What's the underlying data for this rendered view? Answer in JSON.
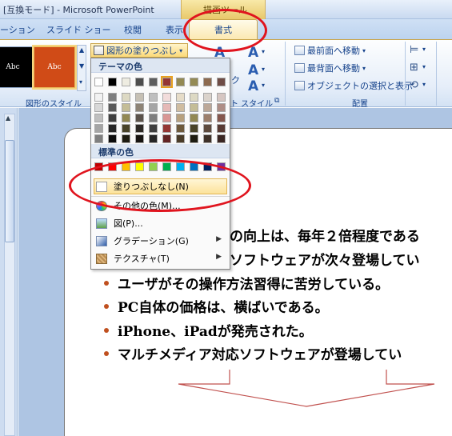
{
  "window": {
    "title": "[互換モード] - Microsoft PowerPoint",
    "contextual_tab_group": "描画ツール"
  },
  "tabs": [
    {
      "label": "ーション"
    },
    {
      "label": "スライド ショー"
    },
    {
      "label": "校閲"
    },
    {
      "label": "表示"
    },
    {
      "label": "書式",
      "active": true
    }
  ],
  "ribbon": {
    "shape_styles": {
      "group_label": "図形のスタイル",
      "style1_text": "Abc",
      "style2_text": "Abc",
      "fill_button": "図形の塗りつぶし"
    },
    "wordart_styles": {
      "group_label_partial": "ト スタイル",
      "fragment": "ク"
    },
    "arrange": {
      "group_label": "配置",
      "bring_front": "最前面へ移動",
      "send_back": "最背面へ移動",
      "selection_pane": "オブジェクトの選択と表示"
    }
  },
  "dropdown": {
    "theme_colors_header": "テーマの色",
    "standard_colors_header": "標準の色",
    "no_fill": "塗りつぶしなし(N)",
    "more_colors": "その他の色(M)...",
    "picture": "図(P)...",
    "gradient": "グラデーション(G)",
    "texture": "テクスチャ(T)",
    "theme_rows": [
      [
        "#ffffff",
        "#000000",
        "#eeece1",
        "#4d4d4d",
        "#5e5e5e",
        "#943634",
        "#938953",
        "#948a54",
        "#8d6a4f",
        "#6f4c45"
      ],
      [
        "#f2f2f2",
        "#7f7f7f",
        "#ddd9c3",
        "#c6c0b4",
        "#bfbfbf",
        "#f2dcdb",
        "#e6dcc8",
        "#ddd9c3",
        "#dbd3cb",
        "#d6c6c1"
      ],
      [
        "#d8d8d8",
        "#595959",
        "#c4bd97",
        "#8e8476",
        "#a5a5a5",
        "#e5b9b7",
        "#cfbca0",
        "#c4bd97",
        "#bca898",
        "#ae8e86"
      ],
      [
        "#bfbfbf",
        "#3f3f3f",
        "#938953",
        "#5b524a",
        "#7f7f7f",
        "#d99694",
        "#b7a07e",
        "#938953",
        "#9c7f6b",
        "#85574d"
      ],
      [
        "#a5a5a5",
        "#262626",
        "#494429",
        "#2c2824",
        "#3f3f3f",
        "#953734",
        "#6e5a3c",
        "#494429",
        "#5d4a3d",
        "#583a33"
      ],
      [
        "#7f7f7f",
        "#0c0c0c",
        "#1d1b10",
        "#171411",
        "#262626",
        "#632423",
        "#4a3c28",
        "#1d1b10",
        "#3e3128",
        "#3a2622"
      ]
    ],
    "standard_colors": [
      "#c00000",
      "#ff0000",
      "#ffc000",
      "#ffff00",
      "#92d050",
      "#00b050",
      "#00b0f0",
      "#0070c0",
      "#002060",
      "#7030a0"
    ]
  },
  "slide": {
    "bullets": [
      {
        "text": "の向上は、毎年２倍程度である",
        "visible_from_left": false
      },
      {
        "text": "ソフトウェアが次々登場してい",
        "visible_from_left": false
      },
      {
        "text": "ユーザがその操作方法習得に苦労している。",
        "visible_from_left": true
      },
      {
        "text": "PC自体の価格は、横ばいである。",
        "visible_from_left": true
      },
      {
        "text": "iPhone、iPadが発売された。",
        "visible_from_left": true
      },
      {
        "text": "マルチメディア対応ソフトウェアが登場してい",
        "visible_from_left": true
      }
    ]
  },
  "colors": {
    "accent_red": "#e0141e",
    "bullet": "#c0501f",
    "style2_fill": "#d04b17",
    "arrow_stroke": "#c0504d"
  }
}
